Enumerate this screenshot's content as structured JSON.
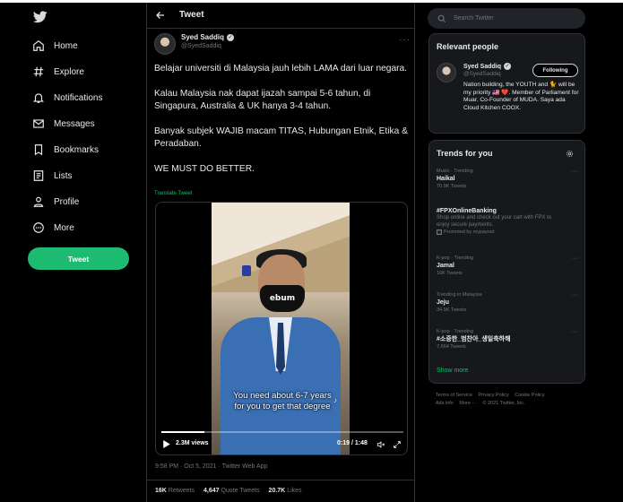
{
  "nav": {
    "items": [
      {
        "label": "Home",
        "icon": "home-icon"
      },
      {
        "label": "Explore",
        "icon": "hashtag-icon"
      },
      {
        "label": "Notifications",
        "icon": "bell-icon"
      },
      {
        "label": "Messages",
        "icon": "envelope-icon"
      },
      {
        "label": "Bookmarks",
        "icon": "bookmark-icon"
      },
      {
        "label": "Lists",
        "icon": "list-icon"
      },
      {
        "label": "Profile",
        "icon": "person-icon"
      },
      {
        "label": "More",
        "icon": "more-circle-icon"
      }
    ],
    "tweet_button": "Tweet"
  },
  "main": {
    "title": "Tweet",
    "author": {
      "name": "Syed Saddiq",
      "handle": "@SyedSaddiq"
    },
    "text": "Belajar universiti di Malaysia jauh lebih LAMA dari luar negara.\n\nKalau Malaysia nak dapat ijazah sampai 5-6 tahun, di Singapura, Australia & UK hanya 3-4 tahun.\n\nBanyak subjek WAJIB macam TITAS, Hubungan Etnik, Etika & Peradaban.\n\nWE MUST DO BETTER.",
    "translate": "Translate Tweet",
    "video": {
      "mask_text": "ebum",
      "subtitle": "You need about 6-7 years\nfor you to get that degree",
      "views": "2.3M views",
      "time": "0:19 / 1:48",
      "progress": 0.176
    },
    "meta": "9:58 PM · Oct 5, 2021 · Twitter Web App",
    "stats": {
      "retweets_count": "16K",
      "retweets_label": "Retweets",
      "quotes_count": "4,647",
      "quotes_label": "Quote Tweets",
      "likes_count": "20.7K",
      "likes_label": "Likes"
    }
  },
  "search": {
    "placeholder": "Search Twitter"
  },
  "relevant": {
    "title": "Relevant people",
    "name": "Syed Saddiq",
    "handle": "@SyedSaddiq",
    "follow_label": "Following",
    "bio": "Nation building, the YOUTH and 🐈 will be my priority 🇲🇾 ❤️. Member of Parliament for Muar. Co-Founder of MUDA. Saya ada Cloud Kitchen COOX."
  },
  "trends": {
    "title": "Trends for you",
    "items": [
      {
        "context": "Music · Trending",
        "name": "Haikal",
        "count": "70.9K Tweets"
      },
      {
        "context": "",
        "name": "#FPXOnlineBanking",
        "desc": "Shop online and check out your cart with FPX to enjoy secure payments.",
        "promoted": "Promoted by mypaynet"
      },
      {
        "context": "K-pop · Trending",
        "name": "Jamal",
        "count": "16K Tweets"
      },
      {
        "context": "Trending in Malaysia",
        "name": "Jeju",
        "count": "34.5K Tweets"
      },
      {
        "context": "K-pop · Trending",
        "name": "#소중한_범찬아_생일축하해",
        "count": "7,664 Tweets"
      }
    ],
    "show_more": "Show more"
  },
  "footer": {
    "links": [
      "Terms of Service",
      "Privacy Policy",
      "Cookie Policy",
      "Ads info",
      "More ···"
    ],
    "copyright": "© 2021 Twitter, Inc."
  },
  "colors": {
    "accent": "#1dba72",
    "background": "#000000",
    "card": "#16181c",
    "border": "#2f3336"
  }
}
